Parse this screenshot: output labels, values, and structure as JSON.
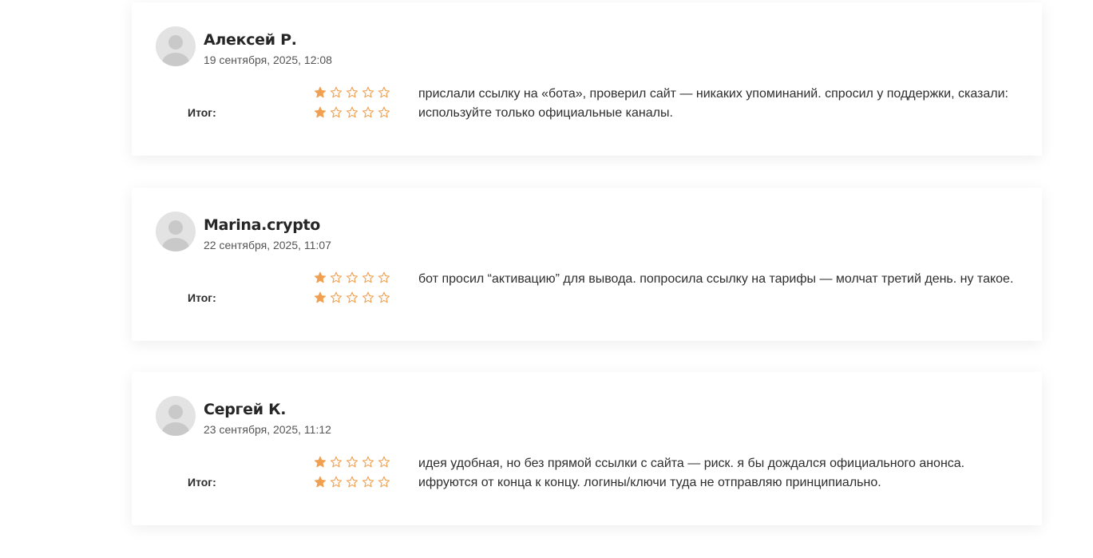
{
  "colors": {
    "star": "#f0a050",
    "avatar_bg": "#e3e3e3",
    "avatar_fg": "#c9c9c9"
  },
  "reviews": [
    {
      "author": "Алексей Р.",
      "date": "19 сентября, 2025, 12:08",
      "total_label": "Итог:",
      "rating_rows": [
        1,
        1
      ],
      "rating_max": 5,
      "text": "прислали ссылку на «бота», проверил сайт — никаких упоминаний. спросил у поддержки, сказали: используйте только официальные каналы."
    },
    {
      "author": "Marina.crypto",
      "date": "22 сентября, 2025, 11:07",
      "total_label": "Итог:",
      "rating_rows": [
        1,
        1
      ],
      "rating_max": 5,
      "text": "бот просил “активацию” для вывода. попросила ссылку на тарифы — молчат третий день. ну такое."
    },
    {
      "author": "Сергей К.",
      "date": "23 сентября, 2025, 11:12",
      "total_label": "Итог:",
      "rating_rows": [
        1,
        1
      ],
      "rating_max": 5,
      "text": "идея удобная, но без прямой ссылки с сайта — риск. я бы дождался официального анонса. ифруются от конца к концу. логины/ключи туда не отправляю принципиально."
    }
  ]
}
